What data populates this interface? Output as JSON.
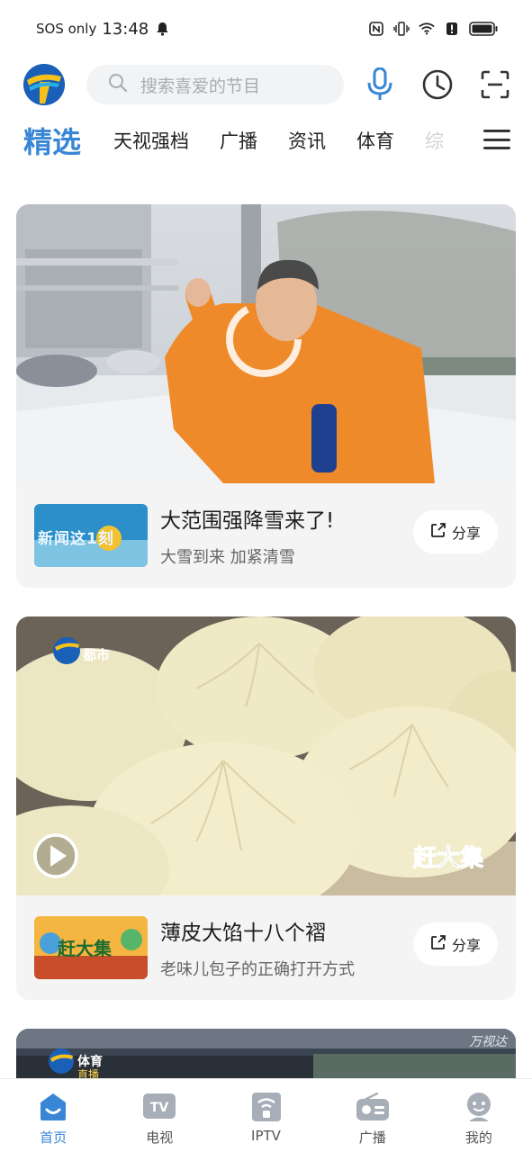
{
  "status_bar": {
    "carrier": "SOS only",
    "time": "13:48",
    "icons": [
      "bell-icon",
      "nfc-icon",
      "vibrate-icon",
      "wifi-icon",
      "alert-icon",
      "battery-icon"
    ]
  },
  "header": {
    "logo": "tianjin-tv-logo",
    "search_placeholder": "搜索喜爱的节目",
    "icons": [
      "microphone-icon",
      "history-clock-icon",
      "scan-icon"
    ]
  },
  "tabs": {
    "items": [
      {
        "label": "精选",
        "active": true
      },
      {
        "label": "天视强档"
      },
      {
        "label": "广播"
      },
      {
        "label": "资讯"
      },
      {
        "label": "体育"
      },
      {
        "label": "综"
      }
    ],
    "menu_icon": "menu-icon"
  },
  "cards": [
    {
      "title": "大范围强降雪来了!",
      "subtitle": "大雪到来 加紧清雪",
      "share_label": "分享",
      "thumb_text": "新闻这1刻",
      "state": "loading"
    },
    {
      "title": "薄皮大馅十八个褶",
      "subtitle": "老味儿包子的正确打开方式",
      "share_label": "分享",
      "thumb_text": "赶大集",
      "channel_bug": "都市",
      "overlay_logo": "赶大集",
      "state": "paused"
    },
    {
      "channel_bug": "体育",
      "channel_sub": "直播",
      "watermark": "万视达"
    }
  ],
  "bottom_nav": [
    {
      "label": "首页",
      "icon": "home-icon",
      "active": true
    },
    {
      "label": "电视",
      "icon": "tv-icon"
    },
    {
      "label": "IPTV",
      "icon": "iptv-icon"
    },
    {
      "label": "广播",
      "icon": "radio-icon"
    },
    {
      "label": "我的",
      "icon": "profile-icon"
    }
  ],
  "colors": {
    "accent": "#3a86d6",
    "card_bg": "#f4f4f5",
    "search_bg": "#f2f3f5"
  }
}
